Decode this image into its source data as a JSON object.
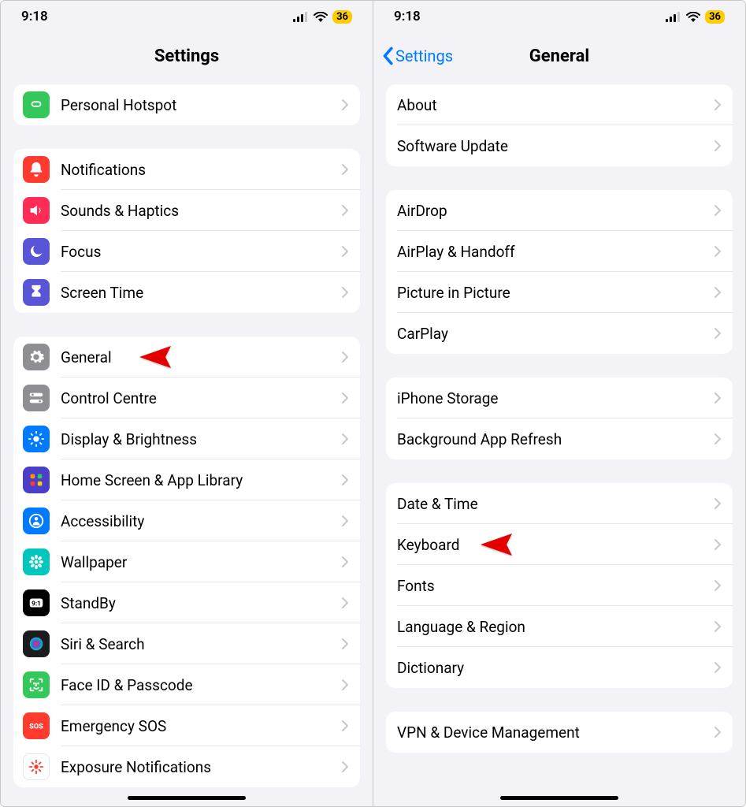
{
  "status": {
    "time": "9:18",
    "battery": "36"
  },
  "left": {
    "title": "Settings",
    "groups": [
      {
        "items": [
          {
            "key": "hotspot",
            "label": "Personal Hotspot",
            "icon": "link-icon",
            "color": "#34c759"
          }
        ]
      },
      {
        "items": [
          {
            "key": "notifications",
            "label": "Notifications",
            "icon": "bell-icon",
            "color": "#ff3b30"
          },
          {
            "key": "sounds",
            "label": "Sounds & Haptics",
            "icon": "speaker-icon",
            "color": "#ff2d55"
          },
          {
            "key": "focus",
            "label": "Focus",
            "icon": "moon-icon",
            "color": "#5856d6"
          },
          {
            "key": "screentime",
            "label": "Screen Time",
            "icon": "hourglass-icon",
            "color": "#5856d6"
          }
        ]
      },
      {
        "items": [
          {
            "key": "general",
            "label": "General",
            "icon": "gear-icon",
            "color": "#8e8e93",
            "arrow": true
          },
          {
            "key": "controlcentre",
            "label": "Control Centre",
            "icon": "switches-icon",
            "color": "#8e8e93"
          },
          {
            "key": "display",
            "label": "Display & Brightness",
            "icon": "sun-icon",
            "color": "#007aff"
          },
          {
            "key": "homescreen",
            "label": "Home Screen & App Library",
            "icon": "grid-icon",
            "color": "#4a3fc9"
          },
          {
            "key": "accessibility",
            "label": "Accessibility",
            "icon": "person-icon",
            "color": "#007aff"
          },
          {
            "key": "wallpaper",
            "label": "Wallpaper",
            "icon": "flower-icon",
            "color": "#00c7be"
          },
          {
            "key": "standby",
            "label": "StandBy",
            "icon": "clock-icon",
            "color": "#000000"
          },
          {
            "key": "siri",
            "label": "Siri & Search",
            "icon": "siri-icon",
            "color": "#1c1c1e"
          },
          {
            "key": "faceid",
            "label": "Face ID & Passcode",
            "icon": "faceid-icon",
            "color": "#34c759"
          },
          {
            "key": "emergencysos",
            "label": "Emergency SOS",
            "icon": "sos-icon",
            "color": "#ff3b30"
          },
          {
            "key": "exposure",
            "label": "Exposure Notifications",
            "icon": "exposure-icon",
            "color": "#ffffff"
          }
        ]
      }
    ]
  },
  "right": {
    "title": "General",
    "back": "Settings",
    "groups": [
      {
        "items": [
          {
            "key": "about",
            "label": "About"
          },
          {
            "key": "software",
            "label": "Software Update"
          }
        ]
      },
      {
        "items": [
          {
            "key": "airdrop",
            "label": "AirDrop"
          },
          {
            "key": "airplay",
            "label": "AirPlay & Handoff"
          },
          {
            "key": "pip",
            "label": "Picture in Picture"
          },
          {
            "key": "carplay",
            "label": "CarPlay"
          }
        ]
      },
      {
        "items": [
          {
            "key": "storage",
            "label": "iPhone Storage"
          },
          {
            "key": "background",
            "label": "Background App Refresh"
          }
        ]
      },
      {
        "items": [
          {
            "key": "datetime",
            "label": "Date & Time"
          },
          {
            "key": "keyboard",
            "label": "Keyboard",
            "arrow": true
          },
          {
            "key": "fonts",
            "label": "Fonts"
          },
          {
            "key": "language",
            "label": "Language & Region"
          },
          {
            "key": "dictionary",
            "label": "Dictionary"
          }
        ]
      },
      {
        "items": [
          {
            "key": "vpn",
            "label": "VPN & Device Management"
          }
        ]
      }
    ]
  }
}
